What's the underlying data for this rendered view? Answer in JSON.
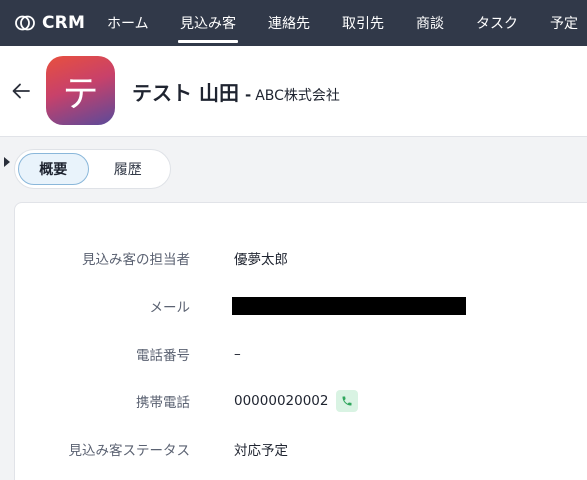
{
  "nav": {
    "brand": "CRM",
    "items": [
      {
        "label": "ホーム"
      },
      {
        "label": "見込み客"
      },
      {
        "label": "連絡先"
      },
      {
        "label": "取引先"
      },
      {
        "label": "商談"
      },
      {
        "label": "タスク"
      },
      {
        "label": "予定"
      }
    ]
  },
  "record": {
    "avatar_letter": "テ",
    "name": "テスト 山田",
    "separator": "-",
    "company": "ABC株式会社"
  },
  "tabs": [
    {
      "label": "概要"
    },
    {
      "label": "履歴"
    }
  ],
  "fields": [
    {
      "label": "見込み客の担当者",
      "value": "優夢太郎"
    },
    {
      "label": "メール",
      "value": ""
    },
    {
      "label": "電話番号",
      "value": "–"
    },
    {
      "label": "携帯電話",
      "value": "00000020002"
    },
    {
      "label": "見込み客ステータス",
      "value": "対応予定"
    }
  ],
  "colors": {
    "nav_bg": "#313949",
    "phone_icon": "#2fa65c"
  }
}
